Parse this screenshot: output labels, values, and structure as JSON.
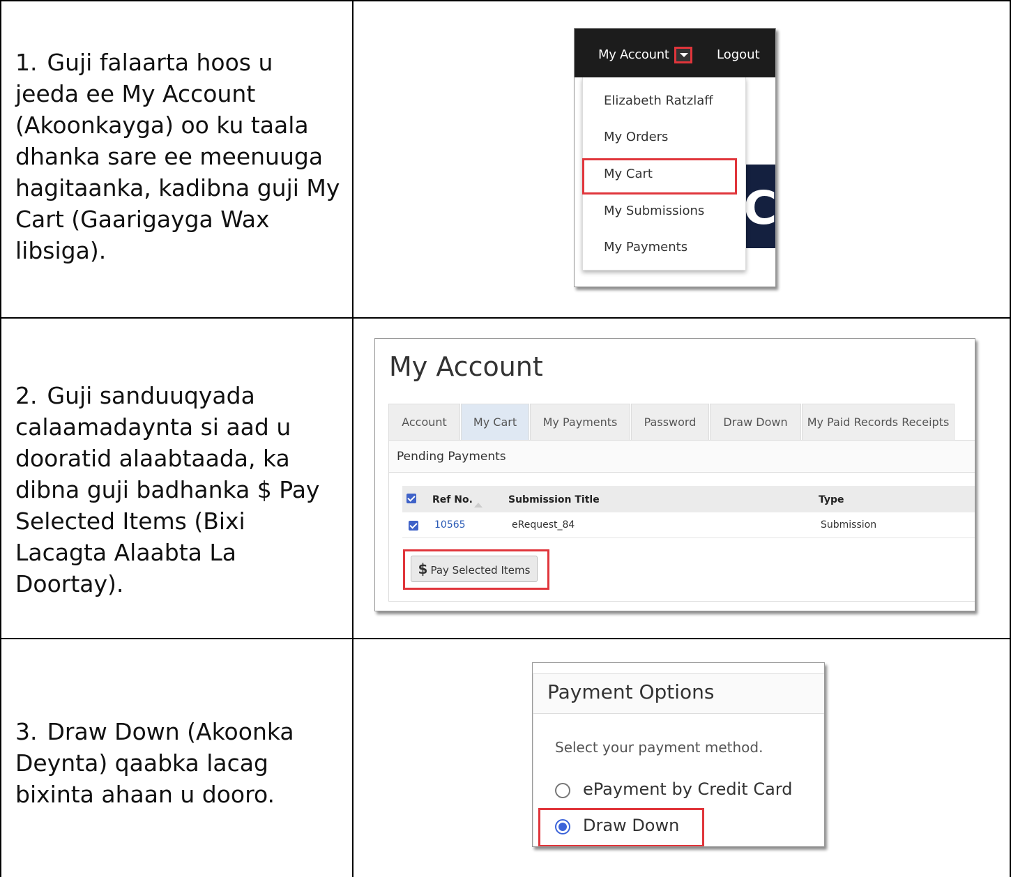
{
  "steps": [
    {
      "number": "1.",
      "text": "Guji falaarta hoos u jeeda ee My Account (Akoonkayga) oo ku taala dhanka sare ee meenuuga hagitaanka, kadibna guji My Cart (Gaarigayga Wax libsiga)."
    },
    {
      "number": "2.",
      "text": "Guji sanduuqyada calaamadaynta si aad u dooratid alaabtaada, ka dibna guji badhanka $ Pay Selected Items (Bixi Lacagta Alaabta La Doortay)."
    },
    {
      "number": "3.",
      "text": "Draw Down (Akoonka Deynta) qaabka lacag bixinta ahaan u dooro."
    }
  ],
  "shot1": {
    "nav_account": "My Account",
    "nav_logout": "Logout",
    "menu_items": [
      "Elizabeth Ratzlaff",
      "My Orders",
      "My Cart",
      "My Submissions",
      "My Payments"
    ],
    "bg_fragment": "CS",
    "highlight_color": "#e0353b"
  },
  "shot2": {
    "title": "My Account",
    "tabs": [
      "Account",
      "My Cart",
      "My Payments",
      "Password",
      "Draw Down",
      "My Paid Records Receipts"
    ],
    "active_tab": "My Cart",
    "panel_title": "Pending Payments",
    "columns": [
      "Ref No.",
      "Submission Title",
      "Type"
    ],
    "row": {
      "ref": "10565",
      "title": "eRequest_84",
      "type": "Submission"
    },
    "button_symbol": "$",
    "button_label": "Pay Selected Items"
  },
  "shot3": {
    "title": "Payment Options",
    "label": "Select your payment method.",
    "options": [
      "ePayment by Credit Card",
      "Draw Down"
    ],
    "selected": "Draw Down"
  }
}
